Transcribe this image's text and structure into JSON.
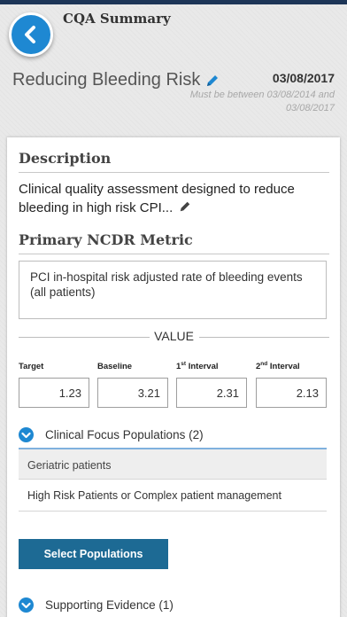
{
  "header": {
    "title": "CQA Summary",
    "back_icon": "chevron-left-icon",
    "colors": {
      "top_strip": "#1d3557",
      "accent": "#1e88d2"
    }
  },
  "cqa": {
    "name": "Reducing Bleeding Risk",
    "edit_icon": "pencil-icon",
    "date": "03/08/2017",
    "date_hint": "Must be between 03/08/2014 and 03/08/2017"
  },
  "description": {
    "title": "Description",
    "text": "Clinical quality assessment designed to reduce bleeding in high risk CPI...",
    "edit_icon": "pencil-icon"
  },
  "metric": {
    "title": "Primary NCDR Metric",
    "value": "PCI in-hospital risk adjusted rate of bleeding events (all patients)"
  },
  "values": {
    "divider_label": "VALUE",
    "fields": [
      {
        "label": "Target",
        "label_sup": "",
        "label_rest": "",
        "value": "1.23"
      },
      {
        "label": "Baseline",
        "label_sup": "",
        "label_rest": "",
        "value": "3.21"
      },
      {
        "label": "1",
        "label_sup": "st",
        "label_rest": " Interval",
        "value": "2.31"
      },
      {
        "label": "2",
        "label_sup": "nd",
        "label_rest": " Interval",
        "value": "2.13"
      }
    ]
  },
  "populations": {
    "title": "Clinical Focus Populations (2)",
    "items": [
      "Geriatric patients",
      "High Risk Patients or Complex patient management"
    ],
    "button": "Select Populations",
    "button_color": "#1d6a94"
  },
  "evidence": {
    "title": "Supporting Evidence (1)"
  }
}
